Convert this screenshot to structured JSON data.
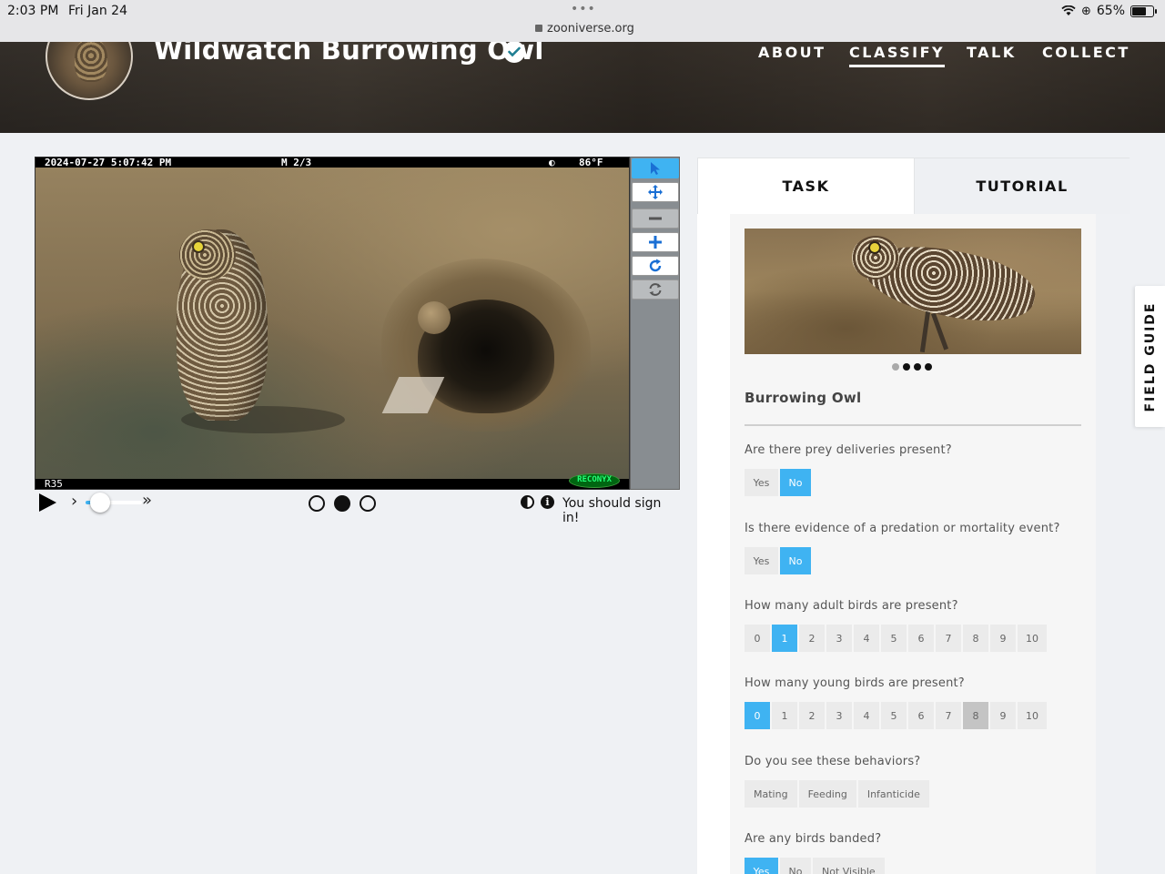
{
  "status_bar": {
    "time": "2:03 PM",
    "date": "Fri Jan 24",
    "url": "zooniverse.org",
    "battery": "65%",
    "icons": [
      "wifi-icon",
      "orientation-lock-icon",
      "battery-icon",
      "lock-icon"
    ]
  },
  "header": {
    "title": "Wildwatch Burrowing Owl",
    "nav": [
      {
        "label": "ABOUT",
        "active": false
      },
      {
        "label": "CLASSIFY",
        "active": true
      },
      {
        "label": "TALK",
        "active": false
      },
      {
        "label": "COLLECT",
        "active": false
      }
    ]
  },
  "viewer": {
    "camera_timestamp": "2024-07-27 5:07:42 PM",
    "camera_frame": "M 2/3",
    "camera_temp": "86°F",
    "camera_id": "R35",
    "camera_brand": "RECONYX",
    "tools": [
      "pointer-icon",
      "pan-icon",
      "zoom-out-icon",
      "zoom-in-icon",
      "rotate-icon",
      "reset-icon"
    ],
    "frames_total": 3,
    "frame_active": 2,
    "playback_speed": 0.25,
    "signin_text": "You should sign in!"
  },
  "task_panel": {
    "tabs": [
      {
        "label": "TASK",
        "active": true
      },
      {
        "label": "TUTORIAL",
        "active": false
      }
    ],
    "carousel_pages": 4,
    "carousel_active": 1,
    "species": "Burrowing Owl",
    "questions": [
      {
        "text": "Are there prey deliveries present?",
        "options": [
          "Yes",
          "No"
        ],
        "selected": "No"
      },
      {
        "text": "Is there evidence of a predation or mortality event?",
        "options": [
          "Yes",
          "No"
        ],
        "selected": "No"
      },
      {
        "text": "How many adult birds are present?",
        "options": [
          "0",
          "1",
          "2",
          "3",
          "4",
          "5",
          "6",
          "7",
          "8",
          "9",
          "10"
        ],
        "selected": "1"
      },
      {
        "text": "How many young birds are present?",
        "options": [
          "0",
          "1",
          "2",
          "3",
          "4",
          "5",
          "6",
          "7",
          "8",
          "9",
          "10"
        ],
        "selected": "0",
        "hover": "8"
      },
      {
        "text": "Do you see these behaviors?",
        "options": [
          "Mating",
          "Feeding",
          "Infanticide"
        ],
        "selected": null
      },
      {
        "text": "Are any birds banded?",
        "options": [
          "Yes",
          "No",
          "Not Visible"
        ],
        "selected": "Yes"
      }
    ]
  },
  "field_guide": {
    "label": "FIELD GUIDE"
  },
  "colors": {
    "accent": "#3fb3f2",
    "background": "#eff1f4"
  }
}
